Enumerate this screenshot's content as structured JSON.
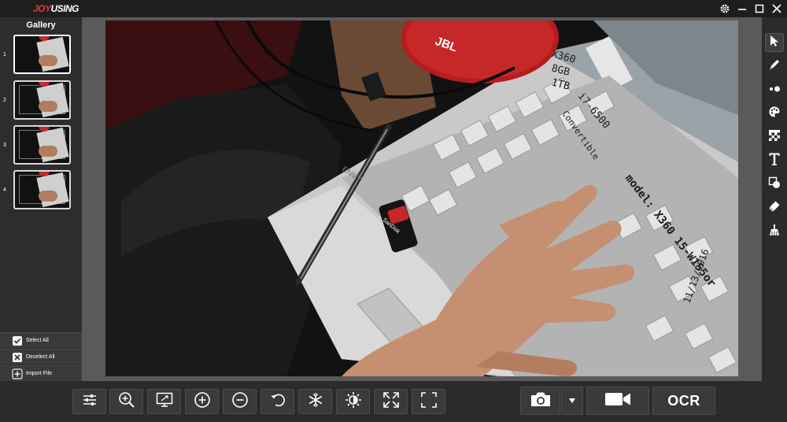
{
  "app": {
    "logo_part1": "JOY",
    "logo_part2": "USING"
  },
  "gallery": {
    "title": "Gallery",
    "items": [
      {
        "number": "1",
        "selected": true
      },
      {
        "number": "2",
        "selected": false
      },
      {
        "number": "3",
        "selected": false
      },
      {
        "number": "4",
        "selected": false
      }
    ],
    "buttons": {
      "select_all": "Select All",
      "deselect_all": "Deselect All",
      "import_file": "Import File"
    }
  },
  "photo": {
    "speaker_brand": "JBL",
    "laptop_brand": "ENVY",
    "usb_brand": "SanDisk",
    "handwriting_line1": "X360",
    "handwriting_line2": "8GB",
    "handwriting_line3": "1TB",
    "handwriting_line4": "i7-6500",
    "handwriting_line5": "Convertible",
    "handwriting_model": "model: X360 15-W155or",
    "handwriting_date": "11/13/2016"
  },
  "tools": [
    {
      "name": "select-tool",
      "icon": "cursor-arrow"
    },
    {
      "name": "pen-tool",
      "icon": "pen"
    },
    {
      "name": "dots-tool",
      "icon": "dots"
    },
    {
      "name": "palette-tool",
      "icon": "palette"
    },
    {
      "name": "mosaic-tool",
      "icon": "checkerboard"
    },
    {
      "name": "text-tool",
      "icon": "letter-t"
    },
    {
      "name": "shape-tool",
      "icon": "shapes"
    },
    {
      "name": "eraser-tool",
      "icon": "eraser"
    },
    {
      "name": "brush-tool",
      "icon": "broom"
    }
  ],
  "bottom": {
    "ocr_label": "OCR",
    "buttons": [
      "settings",
      "zoom",
      "fit-screen",
      "zoom-in",
      "zoom-out",
      "rotate",
      "freeze",
      "brightness",
      "fullscreen",
      "crop"
    ]
  },
  "colors": {
    "accent_red": "#e53935",
    "panel_bg": "#2b2b2b",
    "viewport_bg": "#5a5a5a"
  }
}
